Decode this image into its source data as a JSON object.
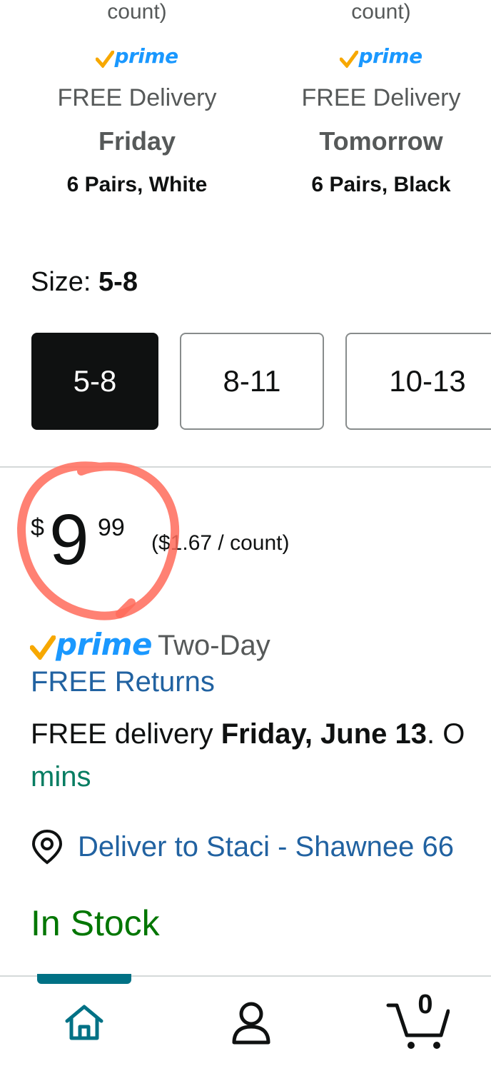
{
  "variants": [
    {
      "count": "count)",
      "prime": "prime",
      "free": "FREE Delivery",
      "day": "Friday",
      "name": "6 Pairs, White"
    },
    {
      "count": "count)",
      "prime": "prime",
      "free": "FREE Delivery",
      "day": "Tomorrow",
      "name": "6 Pairs, Black"
    }
  ],
  "size": {
    "label": "Size: ",
    "selected": "5-8",
    "options": [
      "5-8",
      "8-11",
      "10-13"
    ]
  },
  "price": {
    "symbol": "$",
    "whole": "9",
    "fraction": "99",
    "per_unit": "($1.67 / count)"
  },
  "prime_badge": {
    "word": "prime",
    "suffix": "Two-Day"
  },
  "returns": "FREE Returns",
  "delivery": {
    "prefix": "FREE delivery ",
    "date": "Friday, June 13",
    "suffix": ". O",
    "countdown_tail": "mins"
  },
  "deliver_to": "Deliver to Staci - Shawnee 66",
  "stock": "In Stock",
  "tabs": {
    "cart_count": "0",
    "icons": [
      "home-icon",
      "account-icon",
      "cart-icon"
    ]
  },
  "colors": {
    "prime_blue": "#1a98ff",
    "prime_check": "#f7a800",
    "link": "#2162a1",
    "in_stock": "#007600",
    "accent": "#007185",
    "annotation": "#ff6b5a"
  }
}
